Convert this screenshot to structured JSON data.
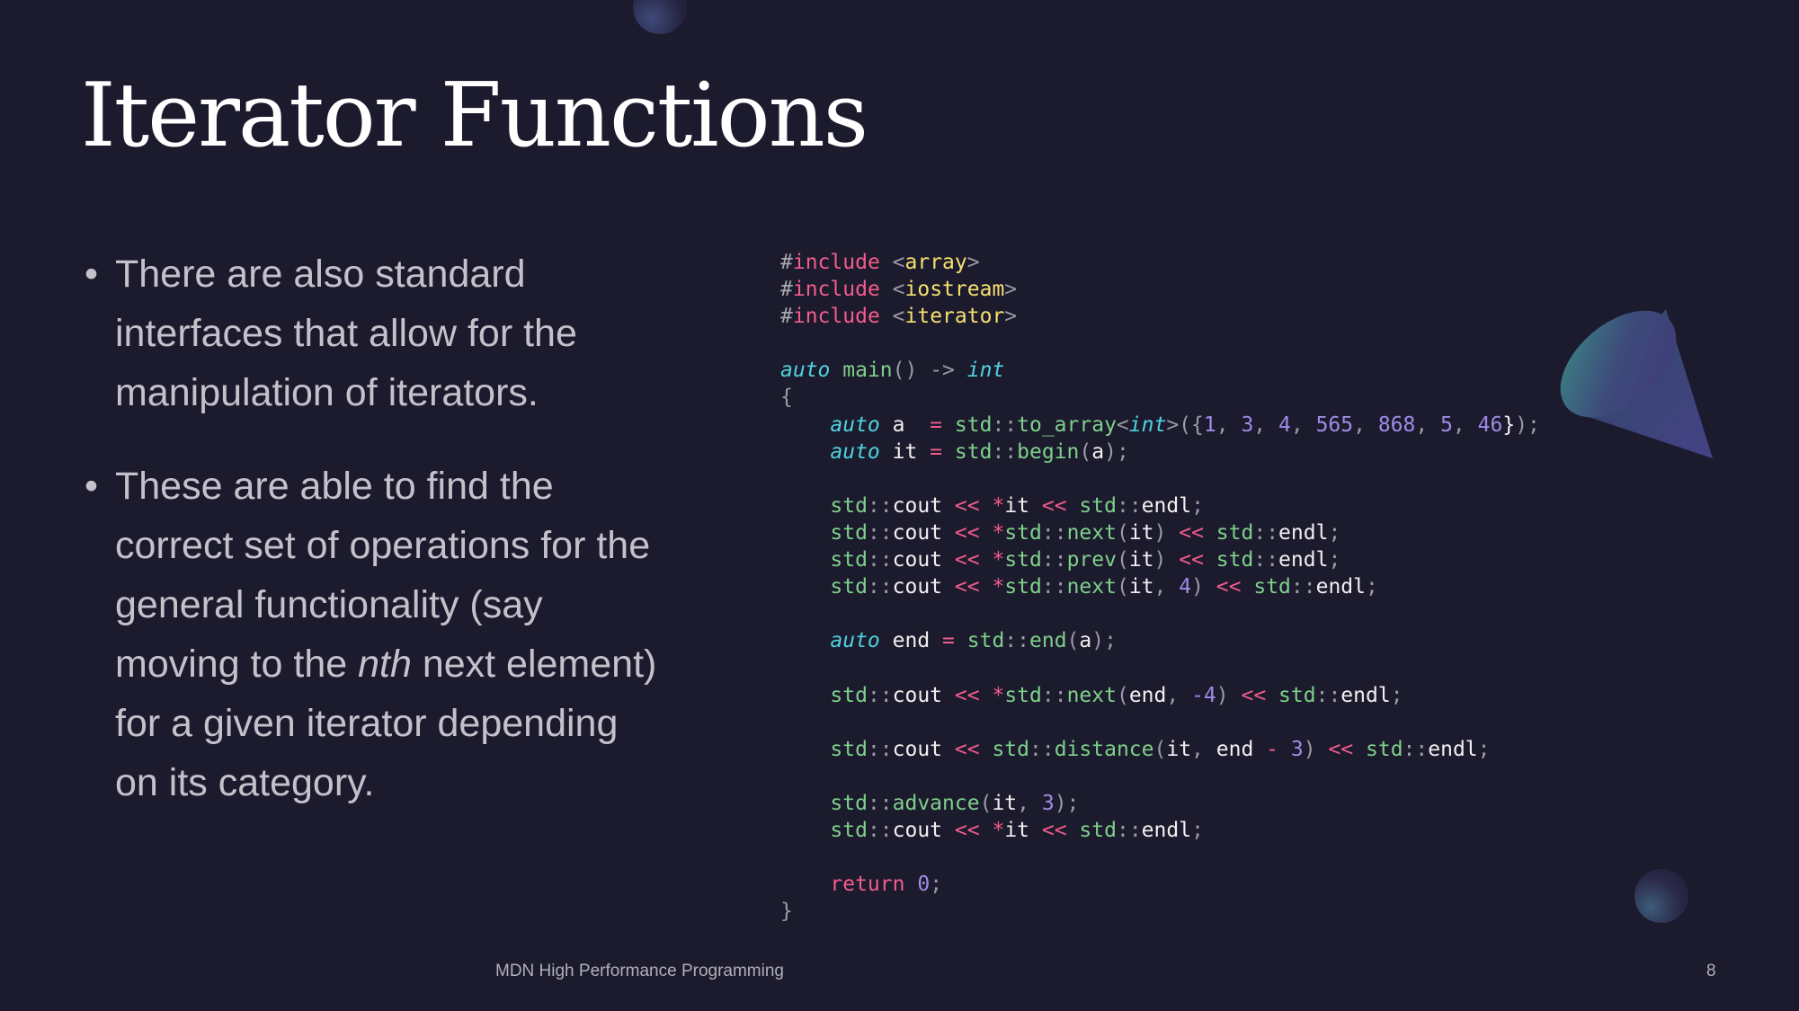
{
  "title": "Iterator Functions",
  "bullets": [
    {
      "text_before": "There are also standard interfaces that allow for the manipulation of iterators.",
      "emph": "",
      "text_after": ""
    },
    {
      "text_before": "These are able to find the correct set of operations for the general functionality (say moving to the ",
      "emph": "nth",
      "text_after": " next element) for a given iterator depending on its category."
    }
  ],
  "bullet_symbol": "•",
  "code_lines": [
    [
      [
        "hash",
        "#"
      ],
      [
        "kw",
        "include"
      ],
      [
        "id",
        " "
      ],
      [
        "p",
        "<"
      ],
      [
        "inc",
        "array"
      ],
      [
        "p",
        ">"
      ]
    ],
    [
      [
        "hash",
        "#"
      ],
      [
        "kw",
        "include"
      ],
      [
        "id",
        " "
      ],
      [
        "p",
        "<"
      ],
      [
        "inc",
        "iostream"
      ],
      [
        "p",
        ">"
      ]
    ],
    [
      [
        "hash",
        "#"
      ],
      [
        "kw",
        "include"
      ],
      [
        "id",
        " "
      ],
      [
        "p",
        "<"
      ],
      [
        "inc",
        "iterator"
      ],
      [
        "p",
        ">"
      ]
    ],
    [],
    [
      [
        "ty",
        "auto"
      ],
      [
        "id",
        " "
      ],
      [
        "fn",
        "main"
      ],
      [
        "p",
        "()"
      ],
      [
        "id",
        " "
      ],
      [
        "p",
        "->"
      ],
      [
        "id",
        " "
      ],
      [
        "ty",
        "int"
      ]
    ],
    [
      [
        "p",
        "{"
      ]
    ],
    [
      [
        "id",
        "    "
      ],
      [
        "ty",
        "auto"
      ],
      [
        "id",
        " a  "
      ],
      [
        "op",
        "="
      ],
      [
        "id",
        " "
      ],
      [
        "fn",
        "std"
      ],
      [
        "p",
        "::"
      ],
      [
        "fn",
        "to_array"
      ],
      [
        "p",
        "<"
      ],
      [
        "ty",
        "int"
      ],
      [
        "p",
        ">({"
      ],
      [
        "num",
        "1"
      ],
      [
        "p",
        ", "
      ],
      [
        "num",
        "3"
      ],
      [
        "p",
        ", "
      ],
      [
        "num",
        "4"
      ],
      [
        "p",
        ", "
      ],
      [
        "num",
        "565"
      ],
      [
        "p",
        ", "
      ],
      [
        "num",
        "868"
      ],
      [
        "p",
        ", "
      ],
      [
        "num",
        "5"
      ],
      [
        "p",
        ", "
      ],
      [
        "num",
        "46"
      ],
      [
        "id",
        "}"
      ],
      [
        "p",
        ");"
      ]
    ],
    [
      [
        "id",
        "    "
      ],
      [
        "ty",
        "auto"
      ],
      [
        "id",
        " it "
      ],
      [
        "op",
        "="
      ],
      [
        "id",
        " "
      ],
      [
        "fn",
        "std"
      ],
      [
        "p",
        "::"
      ],
      [
        "fn",
        "begin"
      ],
      [
        "p",
        "("
      ],
      [
        "id",
        "a"
      ],
      [
        "p",
        ");"
      ]
    ],
    [],
    [
      [
        "id",
        "    "
      ],
      [
        "fn",
        "std"
      ],
      [
        "p",
        "::"
      ],
      [
        "id",
        "cout "
      ],
      [
        "op",
        "<<"
      ],
      [
        "id",
        " "
      ],
      [
        "op",
        "*"
      ],
      [
        "id",
        "it "
      ],
      [
        "op",
        "<<"
      ],
      [
        "id",
        " "
      ],
      [
        "fn",
        "std"
      ],
      [
        "p",
        "::"
      ],
      [
        "id",
        "endl"
      ],
      [
        "p",
        ";"
      ]
    ],
    [
      [
        "id",
        "    "
      ],
      [
        "fn",
        "std"
      ],
      [
        "p",
        "::"
      ],
      [
        "id",
        "cout "
      ],
      [
        "op",
        "<<"
      ],
      [
        "id",
        " "
      ],
      [
        "op",
        "*"
      ],
      [
        "fn",
        "std"
      ],
      [
        "p",
        "::"
      ],
      [
        "fn",
        "next"
      ],
      [
        "p",
        "("
      ],
      [
        "id",
        "it"
      ],
      [
        "p",
        ")"
      ],
      [
        "id",
        " "
      ],
      [
        "op",
        "<<"
      ],
      [
        "id",
        " "
      ],
      [
        "fn",
        "std"
      ],
      [
        "p",
        "::"
      ],
      [
        "id",
        "endl"
      ],
      [
        "p",
        ";"
      ]
    ],
    [
      [
        "id",
        "    "
      ],
      [
        "fn",
        "std"
      ],
      [
        "p",
        "::"
      ],
      [
        "id",
        "cout "
      ],
      [
        "op",
        "<<"
      ],
      [
        "id",
        " "
      ],
      [
        "op",
        "*"
      ],
      [
        "fn",
        "std"
      ],
      [
        "p",
        "::"
      ],
      [
        "fn",
        "prev"
      ],
      [
        "p",
        "("
      ],
      [
        "id",
        "it"
      ],
      [
        "p",
        ")"
      ],
      [
        "id",
        " "
      ],
      [
        "op",
        "<<"
      ],
      [
        "id",
        " "
      ],
      [
        "fn",
        "std"
      ],
      [
        "p",
        "::"
      ],
      [
        "id",
        "endl"
      ],
      [
        "p",
        ";"
      ]
    ],
    [
      [
        "id",
        "    "
      ],
      [
        "fn",
        "std"
      ],
      [
        "p",
        "::"
      ],
      [
        "id",
        "cout "
      ],
      [
        "op",
        "<<"
      ],
      [
        "id",
        " "
      ],
      [
        "op",
        "*"
      ],
      [
        "fn",
        "std"
      ],
      [
        "p",
        "::"
      ],
      [
        "fn",
        "next"
      ],
      [
        "p",
        "("
      ],
      [
        "id",
        "it"
      ],
      [
        "p",
        ", "
      ],
      [
        "num",
        "4"
      ],
      [
        "p",
        ")"
      ],
      [
        "id",
        " "
      ],
      [
        "op",
        "<<"
      ],
      [
        "id",
        " "
      ],
      [
        "fn",
        "std"
      ],
      [
        "p",
        "::"
      ],
      [
        "id",
        "endl"
      ],
      [
        "p",
        ";"
      ]
    ],
    [],
    [
      [
        "id",
        "    "
      ],
      [
        "ty",
        "auto"
      ],
      [
        "id",
        " end "
      ],
      [
        "op",
        "="
      ],
      [
        "id",
        " "
      ],
      [
        "fn",
        "std"
      ],
      [
        "p",
        "::"
      ],
      [
        "fn",
        "end"
      ],
      [
        "p",
        "("
      ],
      [
        "id",
        "a"
      ],
      [
        "p",
        ");"
      ]
    ],
    [],
    [
      [
        "id",
        "    "
      ],
      [
        "fn",
        "std"
      ],
      [
        "p",
        "::"
      ],
      [
        "id",
        "cout "
      ],
      [
        "op",
        "<<"
      ],
      [
        "id",
        " "
      ],
      [
        "op",
        "*"
      ],
      [
        "fn",
        "std"
      ],
      [
        "p",
        "::"
      ],
      [
        "fn",
        "next"
      ],
      [
        "p",
        "("
      ],
      [
        "id",
        "end"
      ],
      [
        "p",
        ", "
      ],
      [
        "num",
        "-4"
      ],
      [
        "p",
        ")"
      ],
      [
        "id",
        " "
      ],
      [
        "op",
        "<<"
      ],
      [
        "id",
        " "
      ],
      [
        "fn",
        "std"
      ],
      [
        "p",
        "::"
      ],
      [
        "id",
        "endl"
      ],
      [
        "p",
        ";"
      ]
    ],
    [],
    [
      [
        "id",
        "    "
      ],
      [
        "fn",
        "std"
      ],
      [
        "p",
        "::"
      ],
      [
        "id",
        "cout "
      ],
      [
        "op",
        "<<"
      ],
      [
        "id",
        " "
      ],
      [
        "fn",
        "std"
      ],
      [
        "p",
        "::"
      ],
      [
        "fn",
        "distance"
      ],
      [
        "p",
        "("
      ],
      [
        "id",
        "it"
      ],
      [
        "p",
        ", "
      ],
      [
        "id",
        "end "
      ],
      [
        "op",
        "-"
      ],
      [
        "id",
        " "
      ],
      [
        "num",
        "3"
      ],
      [
        "p",
        ")"
      ],
      [
        "id",
        " "
      ],
      [
        "op",
        "<<"
      ],
      [
        "id",
        " "
      ],
      [
        "fn",
        "std"
      ],
      [
        "p",
        "::"
      ],
      [
        "id",
        "endl"
      ],
      [
        "p",
        ";"
      ]
    ],
    [],
    [
      [
        "id",
        "    "
      ],
      [
        "fn",
        "std"
      ],
      [
        "p",
        "::"
      ],
      [
        "fn",
        "advance"
      ],
      [
        "p",
        "("
      ],
      [
        "id",
        "it"
      ],
      [
        "p",
        ", "
      ],
      [
        "num",
        "3"
      ],
      [
        "p",
        ");"
      ]
    ],
    [
      [
        "id",
        "    "
      ],
      [
        "fn",
        "std"
      ],
      [
        "p",
        "::"
      ],
      [
        "id",
        "cout "
      ],
      [
        "op",
        "<<"
      ],
      [
        "id",
        " "
      ],
      [
        "op",
        "*"
      ],
      [
        "id",
        "it "
      ],
      [
        "op",
        "<<"
      ],
      [
        "id",
        " "
      ],
      [
        "fn",
        "std"
      ],
      [
        "p",
        "::"
      ],
      [
        "id",
        "endl"
      ],
      [
        "p",
        ";"
      ]
    ],
    [],
    [
      [
        "id",
        "    "
      ],
      [
        "kw",
        "return"
      ],
      [
        "id",
        " "
      ],
      [
        "num",
        "0"
      ],
      [
        "p",
        ";"
      ]
    ],
    [
      [
        "p",
        "}"
      ]
    ]
  ],
  "footer": "MDN High Performance Programming",
  "page_number": "8"
}
